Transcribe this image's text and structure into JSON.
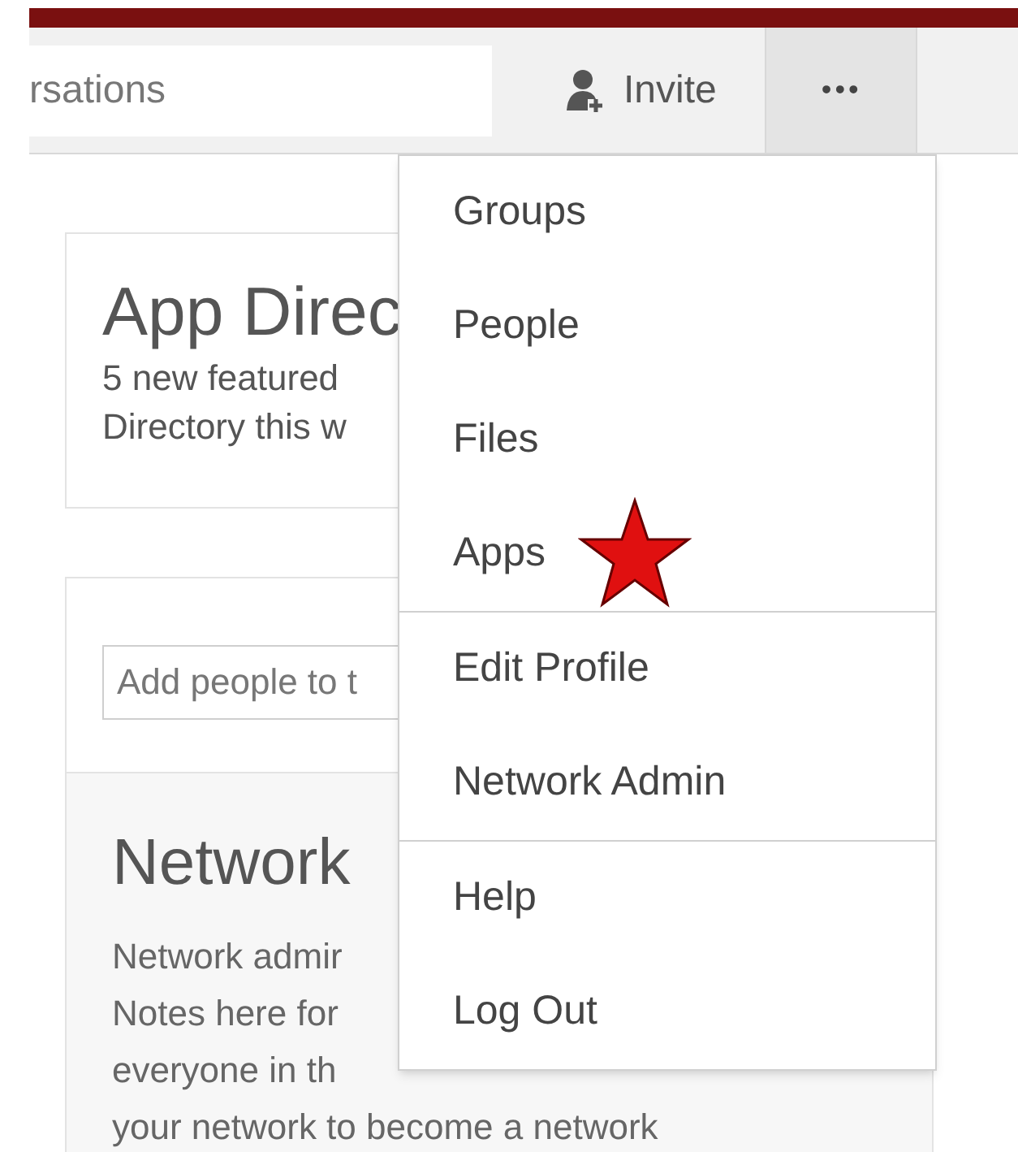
{
  "header": {
    "search": {
      "placeholder": "rsations"
    },
    "invite": {
      "label": "Invite"
    },
    "more": {
      "label": "•••",
      "selected": true
    }
  },
  "app_directory_card": {
    "title": "App Direc",
    "lines": [
      "5 new featured",
      "Directory this w"
    ]
  },
  "people_card": {
    "input": {
      "placeholder": "Add people to t"
    }
  },
  "network_card": {
    "title": "Network",
    "lines": [
      "Network admir",
      "Notes here for",
      "everyone in th",
      "your network to become a network"
    ]
  },
  "menu": {
    "sections": [
      [
        {
          "label": "Groups",
          "starred": false
        },
        {
          "label": "People",
          "starred": false
        },
        {
          "label": "Files",
          "starred": false
        },
        {
          "label": "Apps",
          "starred": true
        }
      ],
      [
        {
          "label": "Edit Profile",
          "starred": false
        },
        {
          "label": "Network Admin",
          "starred": false
        }
      ],
      [
        {
          "label": "Help",
          "starred": false
        },
        {
          "label": "Log Out",
          "starred": false
        }
      ]
    ]
  }
}
